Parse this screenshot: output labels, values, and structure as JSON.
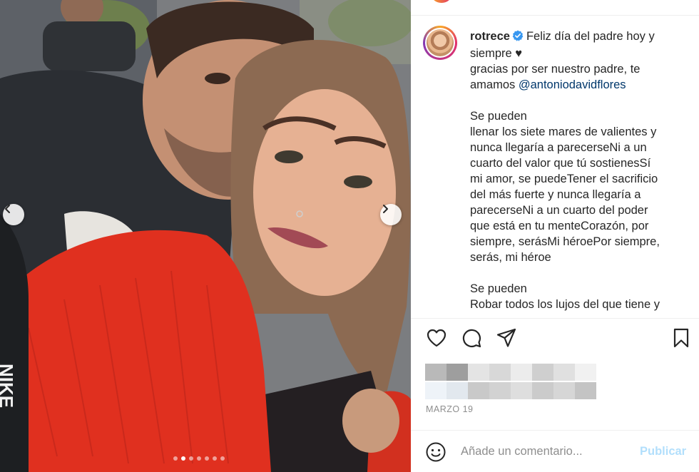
{
  "post": {
    "username": "rotrece",
    "caption_lines": [
      "Feliz día del padre hoy y",
      "siempre",
      "gracias por ser nuestro padre, te",
      "amamos",
      "",
      "Se pueden",
      "llenar los siete mares de valientes y",
      "nunca llegaría a parecerseNi a un",
      "cuarto del valor que tú sostienesSí",
      "mi amor, se puedeTener el sacrificio",
      "del más fuerte y nunca llegaría a",
      "parecerseNi a un cuarto del poder",
      "que está en tu menteCorazón, por",
      "siempre, serásMi héroePor siempre,",
      "serás, mi héroe",
      "",
      "Se pueden",
      "Robar todos los lujos del que tiene y"
    ],
    "heart_emoji": "♥",
    "mention": "@antoniodavidflores",
    "date": "MARZO 19"
  },
  "carousel": {
    "dot_count": 7,
    "active_index": 1
  },
  "comment": {
    "placeholder": "Añade un comentario...",
    "publish_label": "Publicar"
  },
  "colors": {
    "verified": "#3897f0",
    "publish_disabled": "#b2dffc",
    "mention": "#00376b",
    "date": "#8e8e8e"
  },
  "icons": {
    "prev": "chevron-left-icon",
    "next": "chevron-right-icon",
    "like": "heart-icon",
    "comment": "comment-bubble-icon",
    "share": "paper-plane-icon",
    "save": "bookmark-icon",
    "emoji": "smiley-icon",
    "verified": "verified-badge-icon"
  }
}
